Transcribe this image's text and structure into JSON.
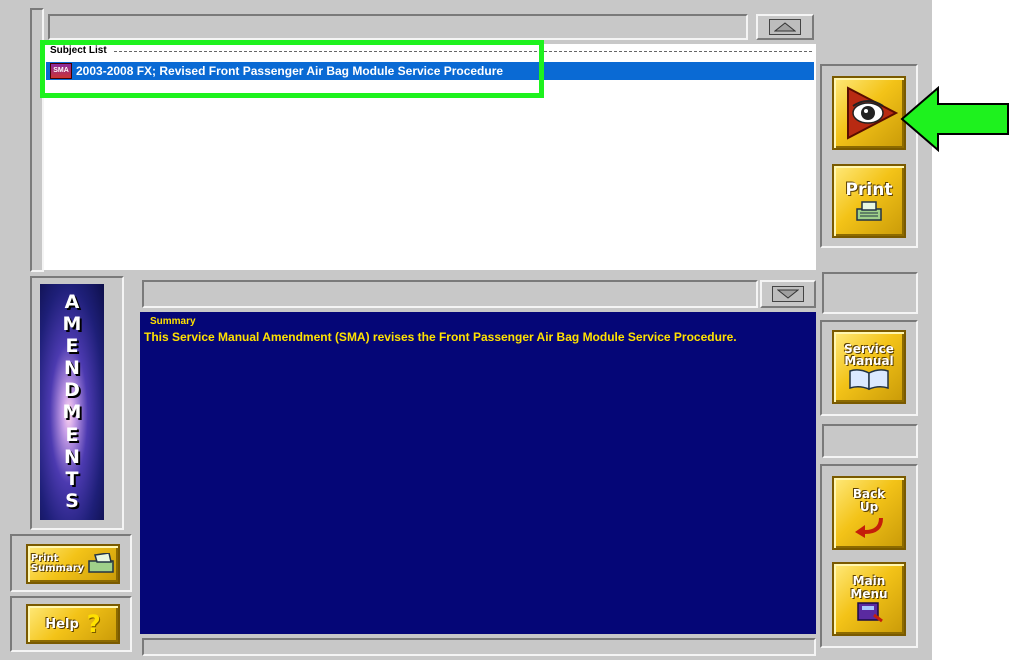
{
  "subject_list": {
    "title": "Subject List",
    "items": [
      {
        "badge": "SMA",
        "text": "2003-2008 FX; Revised Front Passenger Air Bag Module Service Procedure",
        "selected": true
      }
    ]
  },
  "summary": {
    "title": "Summary",
    "text": "This Service Manual Amendment (SMA) revises the Front Passenger Air Bag Module Service Procedure."
  },
  "side_banner": {
    "letters": [
      "A",
      "M",
      "E",
      "N",
      "D",
      "M",
      "E",
      "N",
      "T",
      "S"
    ]
  },
  "buttons": {
    "view": {
      "icon": "eye-arrow-icon"
    },
    "print": {
      "label": "Print"
    },
    "service_manual": {
      "line1": "Service",
      "line2": "Manual"
    },
    "back_up": {
      "line1": "Back",
      "line2": "Up"
    },
    "main_menu": {
      "line1": "Main",
      "line2": "Menu"
    },
    "print_summary": {
      "line1": "Print",
      "line2": "Summary"
    },
    "help": {
      "label": "Help",
      "glyph": "?"
    }
  },
  "colors": {
    "selection": "#0a6ad4",
    "summary_bg": "#050677",
    "summary_text": "#ffe100",
    "highlight_box": "#1ef21e",
    "arrow": "#1ef21e"
  }
}
